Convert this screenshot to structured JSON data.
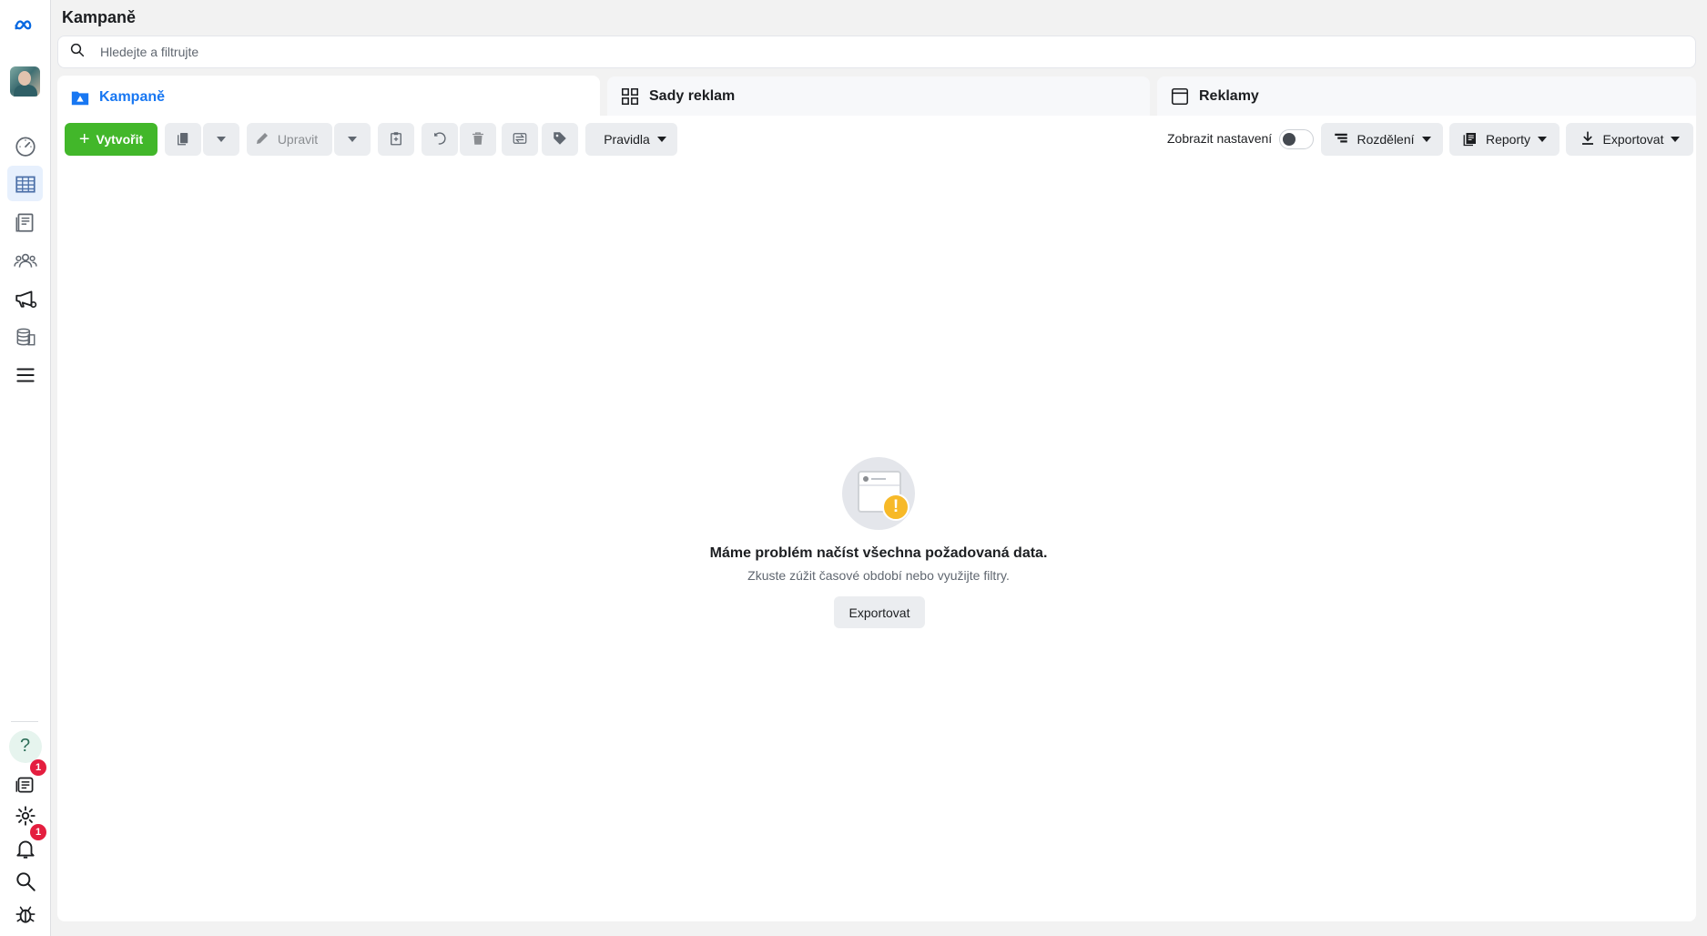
{
  "header": {
    "title": "Kampaně",
    "search_placeholder": "Hledejte a filtrujte"
  },
  "tabs": [
    {
      "label": "Kampaně",
      "icon": "campaign-folder-icon",
      "active": true
    },
    {
      "label": "Sady reklam",
      "icon": "ad-sets-grid-icon",
      "active": false
    },
    {
      "label": "Reklamy",
      "icon": "ads-window-icon",
      "active": false
    }
  ],
  "toolbar": {
    "create_label": "Vytvořit",
    "edit_label": "Upravit",
    "rules_label": "Pravidla",
    "show_settings_label": "Zobrazit nastavení",
    "breakdown_label": "Rozdělení",
    "reports_label": "Reporty",
    "export_label": "Exportovat"
  },
  "empty_state": {
    "title": "Máme problém načíst všechna požadovaná data.",
    "subtitle": "Zkuste zúžit časové období nebo využijte filtry.",
    "button_label": "Exportovat"
  },
  "rail": {
    "notifications_badge": "1",
    "news_badge": "1"
  },
  "colors": {
    "accent": "#1877f2",
    "create": "#42b72a",
    "badge": "#e41e3f",
    "warning": "#f7b928"
  }
}
